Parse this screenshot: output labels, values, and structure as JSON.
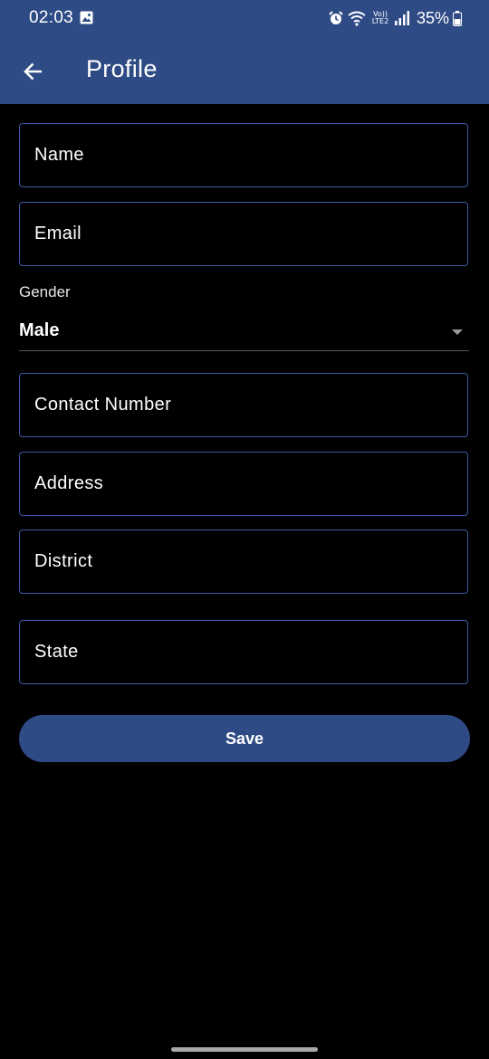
{
  "status_bar": {
    "time": "02:03",
    "network_label": "Vo)) LTE2",
    "battery": "35%"
  },
  "header": {
    "title": "Profile"
  },
  "form": {
    "name_placeholder": "Name",
    "email_placeholder": "Email",
    "gender_label": "Gender",
    "gender_value": "Male",
    "contact_placeholder": "Contact Number",
    "address_placeholder": "Address",
    "district_placeholder": "District",
    "state_placeholder": "State",
    "save_label": "Save"
  },
  "colors": {
    "app_bar": "#2f4b85",
    "field_border": "#3d5aa8",
    "background": "#000000",
    "text": "#ffffff"
  },
  "icons": {
    "back": "arrow-left-icon",
    "gallery": "image-icon",
    "alarm": "alarm-icon",
    "wifi": "wifi-icon",
    "signal": "signal-icon",
    "battery": "battery-icon",
    "dropdown": "triangle-down-icon"
  }
}
